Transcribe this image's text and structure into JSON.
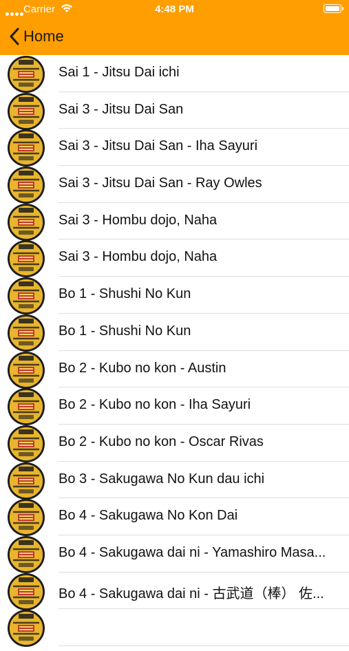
{
  "status_bar": {
    "carrier": "Carrier",
    "time": "4:48 PM"
  },
  "nav": {
    "back_label": "Home"
  },
  "colors": {
    "nav_bar": "#fe9e00",
    "logo_fill": "#e8b52c"
  },
  "items": [
    {
      "title": "Sai 1 - Jitsu Dai ichi"
    },
    {
      "title": "Sai 3 - Jitsu Dai San"
    },
    {
      "title": "Sai 3 - Jitsu Dai San - Iha Sayuri"
    },
    {
      "title": "Sai 3 - Jitsu Dai San - Ray Owles"
    },
    {
      "title": "Sai 3 - Hombu dojo, Naha"
    },
    {
      "title": "Sai 3 - Hombu dojo, Naha"
    },
    {
      "title": "Bo 1 - Shushi No Kun"
    },
    {
      "title": "Bo 1 - Shushi No Kun"
    },
    {
      "title": "Bo 2 - Kubo no kon - Austin"
    },
    {
      "title": "Bo 2 - Kubo no kon - Iha Sayuri"
    },
    {
      "title": "Bo 2 - Kubo no kon - Oscar Rivas"
    },
    {
      "title": "Bo 3 - Sakugawa No Kun dau ichi"
    },
    {
      "title": "Bo 4 - Sakugawa No Kon Dai"
    },
    {
      "title": "Bo 4 - Sakugawa dai ni - Yamashiro Masa..."
    },
    {
      "title": "Bo 4 - Sakugawa dai ni - 古武道（棒） 佐..."
    },
    {
      "title": ""
    }
  ]
}
